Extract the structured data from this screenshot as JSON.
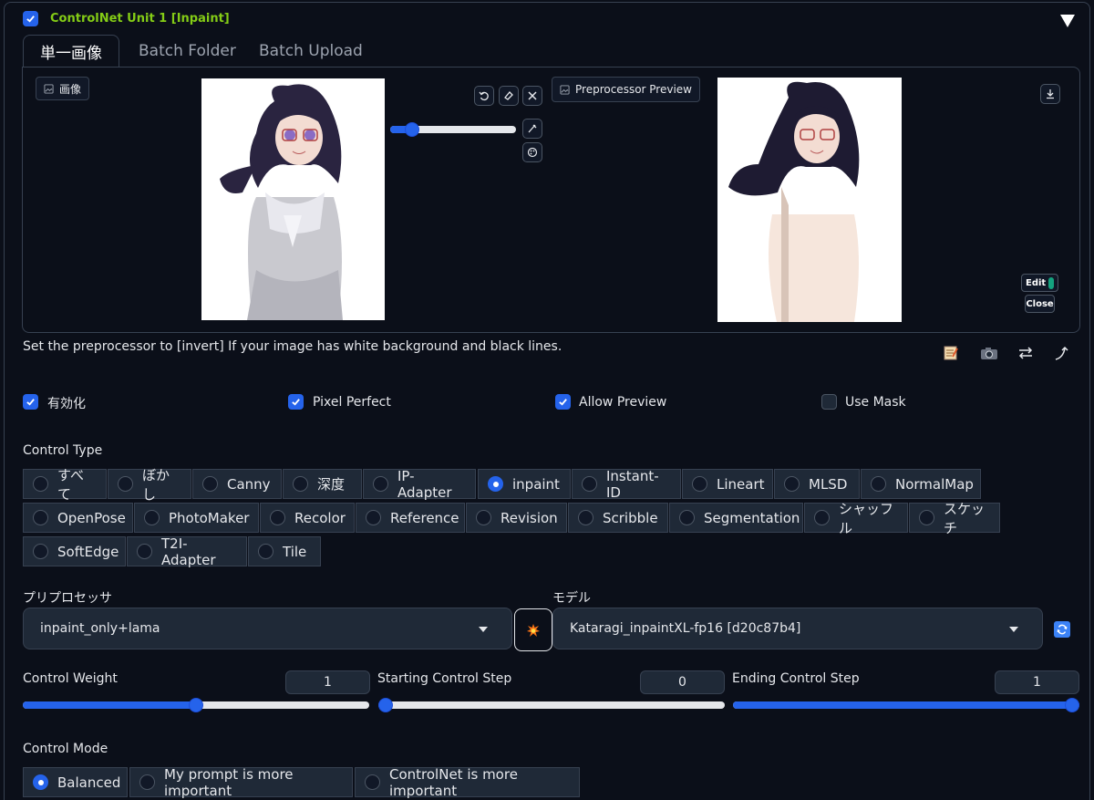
{
  "unit": {
    "title": "ControlNet Unit 1  [Inpaint]",
    "enabled": true
  },
  "tabs": [
    {
      "label": "単一画像",
      "active": true
    },
    {
      "label": "Batch Folder",
      "active": false
    },
    {
      "label": "Batch Upload",
      "active": false
    }
  ],
  "image_panel": {
    "chip_label": "画像"
  },
  "preview_panel": {
    "chip_label": "Preprocessor Preview",
    "edit_label": "Edit",
    "close_label": "Close"
  },
  "hint_text": "Set the preprocessor to [invert] If your image has white background and black lines.",
  "toggles": [
    {
      "label": "有効化",
      "checked": true
    },
    {
      "label": "Pixel Perfect",
      "checked": true
    },
    {
      "label": "Allow Preview",
      "checked": true
    },
    {
      "label": "Use Mask",
      "checked": false
    }
  ],
  "control_type": {
    "label": "Control Type",
    "selected": "inpaint",
    "options": [
      "すべて",
      "ぼかし",
      "Canny",
      "深度",
      "IP-Adapter",
      "inpaint",
      "Instant-ID",
      "Lineart",
      "MLSD",
      "NormalMap",
      "OpenPose",
      "PhotoMaker",
      "Recolor",
      "Reference",
      "Revision",
      "Scribble",
      "Segmentation",
      "シャッフル",
      "スケッチ",
      "SoftEdge",
      "T2I-Adapter",
      "Tile"
    ]
  },
  "preprocessor": {
    "label": "プリプロセッサ",
    "value": "inpaint_only+lama"
  },
  "model": {
    "label": "モデル",
    "value": "Kataragi_inpaintXL-fp16 [d20c87b4]"
  },
  "sliders": [
    {
      "label": "Control Weight",
      "value": "1",
      "fraction": 0.5
    },
    {
      "label": "Starting Control Step",
      "value": "0",
      "fraction": 0.0
    },
    {
      "label": "Ending Control Step",
      "value": "1",
      "fraction": 1.0
    }
  ],
  "control_mode": {
    "label": "Control Mode",
    "selected": "Balanced",
    "options": [
      "Balanced",
      "My prompt is more important",
      "ControlNet is more important"
    ]
  },
  "colors": {
    "accent": "#2563eb",
    "title_green": "#84cc16",
    "background": "#0b0f19"
  }
}
